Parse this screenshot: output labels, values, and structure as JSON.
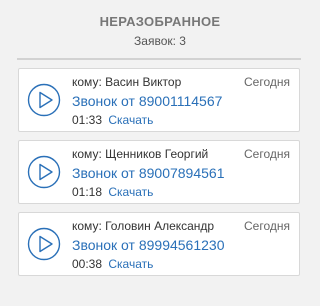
{
  "header": {
    "title": "НЕРАЗОБРАННОЕ",
    "count_label": "Заявок: 3"
  },
  "colors": {
    "accent": "#2a70b8",
    "divider": "#d2d2d2",
    "background": "#f2f2f2"
  },
  "calls": [
    {
      "to": "кому: Васин Виктор",
      "when": "Сегодня",
      "call_label": "Звонок от 89001114567",
      "duration": "01:33",
      "download_label": "Скачать",
      "icon": "play-icon"
    },
    {
      "to": "кому: Щенников Георгий",
      "when": "Сегодня",
      "call_label": "Звонок от 89007894561",
      "duration": "01:18",
      "download_label": "Скачать",
      "icon": "play-icon"
    },
    {
      "to": "кому: Головин Александр",
      "when": "Сегодня",
      "call_label": "Звонок от 89994561230",
      "duration": "00:38",
      "download_label": "Скачать",
      "icon": "play-icon"
    }
  ]
}
